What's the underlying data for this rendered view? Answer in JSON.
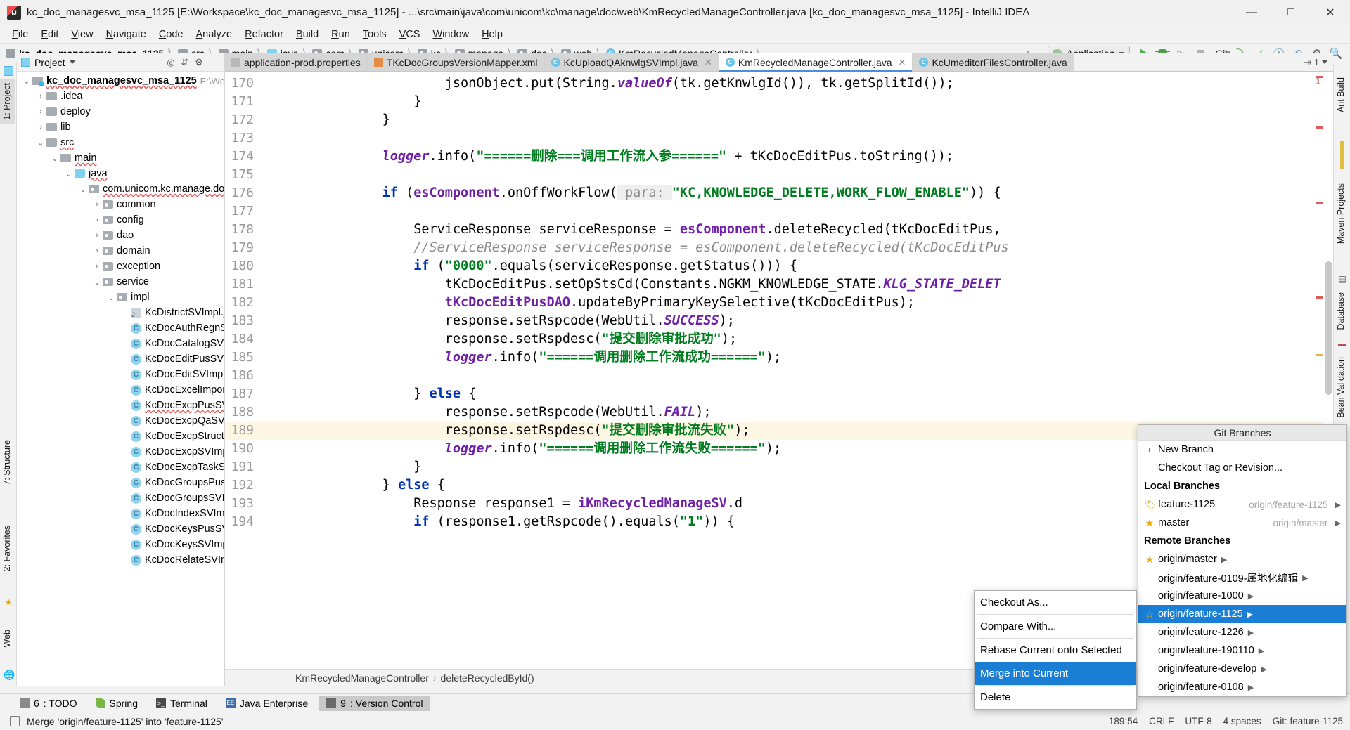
{
  "window": {
    "title": "kc_doc_managesvc_msa_1125 [E:\\Workspace\\kc_doc_managesvc_msa_1125] - ...\\src\\main\\java\\com\\unicom\\kc\\manage\\doc\\web\\KmRecycledManageController.java [kc_doc_managesvc_msa_1125] - IntelliJ IDEA",
    "minimize": "—",
    "maximize": "□",
    "close": "✕"
  },
  "menubar": [
    "File",
    "Edit",
    "View",
    "Navigate",
    "Code",
    "Analyze",
    "Refactor",
    "Build",
    "Run",
    "Tools",
    "VCS",
    "Window",
    "Help"
  ],
  "navbar": {
    "crumbs": [
      {
        "label": "kc_doc_managesvc_msa_1125",
        "icon": "module-folder-icon",
        "type": "mod"
      },
      {
        "label": "src",
        "icon": "folder-icon",
        "type": "plain"
      },
      {
        "label": "main",
        "icon": "folder-icon",
        "type": "plain"
      },
      {
        "label": "java",
        "icon": "source-folder-icon",
        "type": "blue"
      },
      {
        "label": "com",
        "icon": "package-icon",
        "type": "pkg"
      },
      {
        "label": "unicom",
        "icon": "package-icon",
        "type": "pkg"
      },
      {
        "label": "kc",
        "icon": "package-icon",
        "type": "pkg"
      },
      {
        "label": "manage",
        "icon": "package-icon",
        "type": "pkg"
      },
      {
        "label": "doc",
        "icon": "package-icon",
        "type": "pkg"
      },
      {
        "label": "web",
        "icon": "package-icon",
        "type": "pkg"
      },
      {
        "label": "KmRecycledManageController",
        "icon": "class-icon",
        "type": "cls"
      }
    ],
    "run_config": "Application",
    "git_label": "Git:"
  },
  "left_strip": [
    {
      "label": "1: Project",
      "active": true
    },
    {
      "label": "7: Structure",
      "active": false
    },
    {
      "label": "2: Favorites",
      "active": false
    },
    {
      "label": "Web",
      "active": false
    }
  ],
  "right_strip": [
    {
      "label": "Ant Build"
    },
    {
      "label": "Maven Projects"
    },
    {
      "label": "Database"
    },
    {
      "label": "Bean Validation"
    }
  ],
  "project_panel": {
    "header": "Project",
    "tree": [
      {
        "indent": 0,
        "twisty": "⌄",
        "icon": "module-folder-icon",
        "kind": "mod",
        "label": "kc_doc_managesvc_msa_1125",
        "bold": true,
        "wavy": true,
        "suffix": "E:\\Workspa"
      },
      {
        "indent": 1,
        "twisty": "›",
        "icon": "folder-icon",
        "kind": "plain",
        "label": ".idea"
      },
      {
        "indent": 1,
        "twisty": "›",
        "icon": "folder-icon",
        "kind": "plain",
        "label": "deploy"
      },
      {
        "indent": 1,
        "twisty": "›",
        "icon": "folder-icon",
        "kind": "plain",
        "label": "lib"
      },
      {
        "indent": 1,
        "twisty": "⌄",
        "icon": "folder-icon",
        "kind": "plain",
        "label": "src",
        "wavy": true
      },
      {
        "indent": 2,
        "twisty": "⌄",
        "icon": "folder-icon",
        "kind": "plain",
        "label": "main",
        "wavy": true
      },
      {
        "indent": 3,
        "twisty": "⌄",
        "icon": "source-folder-icon",
        "kind": "blue",
        "label": "java",
        "wavy": true
      },
      {
        "indent": 4,
        "twisty": "⌄",
        "icon": "package-icon",
        "kind": "pkg",
        "label": "com.unicom.kc.manage.doc",
        "wavy": true
      },
      {
        "indent": 5,
        "twisty": "›",
        "icon": "package-icon",
        "kind": "pkg",
        "label": "common"
      },
      {
        "indent": 5,
        "twisty": "›",
        "icon": "package-icon",
        "kind": "pkg",
        "label": "config"
      },
      {
        "indent": 5,
        "twisty": "›",
        "icon": "package-icon",
        "kind": "pkg",
        "label": "dao"
      },
      {
        "indent": 5,
        "twisty": "›",
        "icon": "package-icon",
        "kind": "pkg",
        "label": "domain"
      },
      {
        "indent": 5,
        "twisty": "›",
        "icon": "package-icon",
        "kind": "pkg",
        "label": "exception"
      },
      {
        "indent": 5,
        "twisty": "⌄",
        "icon": "package-icon",
        "kind": "pkg",
        "label": "service"
      },
      {
        "indent": 6,
        "twisty": "⌄",
        "icon": "package-icon",
        "kind": "pkg",
        "label": "impl"
      },
      {
        "indent": 7,
        "twisty": "",
        "icon": "java-file-icon",
        "kind": "java",
        "label": "KcDistrictSVImpl.jav"
      },
      {
        "indent": 7,
        "twisty": "",
        "icon": "class-icon",
        "kind": "cls",
        "label": "KcDocAuthRegnSVI"
      },
      {
        "indent": 7,
        "twisty": "",
        "icon": "class-icon",
        "kind": "cls",
        "label": "KcDocCatalogSVIm"
      },
      {
        "indent": 7,
        "twisty": "",
        "icon": "class-icon",
        "kind": "cls",
        "label": "KcDocEditPusSVImp"
      },
      {
        "indent": 7,
        "twisty": "",
        "icon": "class-icon",
        "kind": "cls",
        "label": "KcDocEditSVImpl"
      },
      {
        "indent": 7,
        "twisty": "",
        "icon": "class-icon",
        "kind": "cls",
        "label": "KcDocExcelImportS"
      },
      {
        "indent": 7,
        "twisty": "",
        "icon": "class-icon",
        "kind": "cls",
        "label": "KcDocExcpPusSVIm",
        "wavy": true
      },
      {
        "indent": 7,
        "twisty": "",
        "icon": "class-icon",
        "kind": "cls",
        "label": "KcDocExcpQaSVImp"
      },
      {
        "indent": 7,
        "twisty": "",
        "icon": "class-icon",
        "kind": "cls",
        "label": "KcDocExcpStructSV"
      },
      {
        "indent": 7,
        "twisty": "",
        "icon": "class-icon",
        "kind": "cls",
        "label": "KcDocExcpSVImpl"
      },
      {
        "indent": 7,
        "twisty": "",
        "icon": "class-icon",
        "kind": "cls",
        "label": "KcDocExcpTaskSVIm"
      },
      {
        "indent": 7,
        "twisty": "",
        "icon": "class-icon",
        "kind": "cls",
        "label": "KcDocGroupsPusSV"
      },
      {
        "indent": 7,
        "twisty": "",
        "icon": "class-icon",
        "kind": "cls",
        "label": "KcDocGroupsSVImp"
      },
      {
        "indent": 7,
        "twisty": "",
        "icon": "class-icon",
        "kind": "cls",
        "label": "KcDocIndexSVImpl"
      },
      {
        "indent": 7,
        "twisty": "",
        "icon": "class-icon",
        "kind": "cls",
        "label": "KcDocKeysPusSVIm"
      },
      {
        "indent": 7,
        "twisty": "",
        "icon": "class-icon",
        "kind": "cls",
        "label": "KcDocKeysSVImpl"
      },
      {
        "indent": 7,
        "twisty": "",
        "icon": "class-icon",
        "kind": "cls",
        "label": "KcDocRelateSVImpl"
      }
    ]
  },
  "editor": {
    "tabs": [
      {
        "label": "application-prod.properties",
        "icon": "properties-file-icon",
        "kind": "prop",
        "active": false,
        "closable": false
      },
      {
        "label": "TKcDocGroupsVersionMapper.xml",
        "icon": "xml-file-icon",
        "kind": "xml",
        "active": false,
        "closable": false
      },
      {
        "label": "KcUploadQAknwlgSVImpl.java",
        "icon": "class-icon",
        "kind": "cls",
        "active": false,
        "closable": true
      },
      {
        "label": "KmRecycledManageController.java",
        "icon": "class-icon",
        "kind": "cls",
        "active": true,
        "closable": true
      },
      {
        "label": "KcUmeditorFilesController.java",
        "icon": "class-icon",
        "kind": "cls",
        "active": false,
        "closable": false
      }
    ],
    "tabs_overflow": "⇥ 1",
    "first_line": 170,
    "highlighted_line": 189,
    "lines": [
      {
        "n": 170,
        "html": "                    <span class=\"plain\">jsonObject.put(String.</span><span class=\"st\">valueOf</span><span class=\"plain\">(tk.getKnwlgId()), tk.getSplitId());</span>"
      },
      {
        "n": 171,
        "html": "                <span class=\"plain\">}</span>"
      },
      {
        "n": 172,
        "html": "            <span class=\"plain\">}</span>"
      },
      {
        "n": 173,
        "html": ""
      },
      {
        "n": 174,
        "html": "            <span class=\"st\">logger</span><span class=\"plain\">.info(</span><span class=\"str\">\"======删除===调用工作流入参======\"</span><span class=\"plain\"> + tKcDocEditPus.toString());</span>"
      },
      {
        "n": 175,
        "html": ""
      },
      {
        "n": 176,
        "html": "            <span class=\"kw\">if</span><span class=\"plain\"> (</span><span class=\"fld\">esComponent</span><span class=\"plain\">.onOffWorkFlow(</span><span class=\"hint\"> para: </span><span class=\"str\">\"KC,KNOWLEDGE_DELETE,WORK_FLOW_ENABLE\"</span><span class=\"plain\">)) {</span>"
      },
      {
        "n": 177,
        "html": ""
      },
      {
        "n": 178,
        "html": "                <span class=\"plain\">ServiceResponse serviceResponse = </span><span class=\"fld\">esComponent</span><span class=\"plain\">.deleteRecycled(tKcDocEditPus,</span>"
      },
      {
        "n": 179,
        "html": "                <span class=\"cmt\">//ServiceResponse serviceResponse = esComponent.deleteRecycled(tKcDocEditPus</span>"
      },
      {
        "n": 180,
        "html": "                <span class=\"kw\">if</span><span class=\"plain\"> (</span><span class=\"str\">\"0000\"</span><span class=\"plain\">.equals(serviceResponse.getStatus())) {</span>"
      },
      {
        "n": 181,
        "html": "                    <span class=\"plain\">tKcDocEditPus.setOpStsCd(Constants.NGKM_KNOWLEDGE_STATE.</span><span class=\"st\">KLG_STATE_DELET</span>"
      },
      {
        "n": 182,
        "html": "                    <span class=\"fld\">tKcDocEditPusDAO</span><span class=\"plain\">.updateByPrimaryKeySelective(tKcDocEditPus);</span>"
      },
      {
        "n": 183,
        "html": "                    <span class=\"plain\">response.setRspcode(WebUtil.</span><span class=\"st\">SUCCESS</span><span class=\"plain\">);</span>"
      },
      {
        "n": 184,
        "html": "                    <span class=\"plain\">response.setRspdesc(</span><span class=\"str\">\"提交删除审批成功\"</span><span class=\"plain\">);</span>"
      },
      {
        "n": 185,
        "html": "                    <span class=\"st\">logger</span><span class=\"plain\">.info(</span><span class=\"str\">\"======调用删除工作流成功======\"</span><span class=\"plain\">);</span>"
      },
      {
        "n": 186,
        "html": ""
      },
      {
        "n": 187,
        "html": "                <span class=\"plain\">} </span><span class=\"kw\">else</span><span class=\"plain\"> {</span>"
      },
      {
        "n": 188,
        "html": "                    <span class=\"plain\">response.setRspcode(WebUtil.</span><span class=\"st\">FAIL</span><span class=\"plain\">);</span>"
      },
      {
        "n": 189,
        "html": "                    <span class=\"plain\">response.setRspdesc(</span><span class=\"str\">\"提交删除审批流失败\"</span><span class=\"plain\">);</span>"
      },
      {
        "n": 190,
        "html": "                    <span class=\"st\">logger</span><span class=\"plain\">.info(</span><span class=\"str\">\"======调用删除工作流失败======\"</span><span class=\"plain\">);</span>"
      },
      {
        "n": 191,
        "html": "                <span class=\"plain\">}</span>"
      },
      {
        "n": 192,
        "html": "            <span class=\"plain\">} </span><span class=\"kw\">else</span><span class=\"plain\"> {</span>"
      },
      {
        "n": 193,
        "html": "                <span class=\"plain\">Response response1 = </span><span class=\"fld\">iKmRecycledManageSV</span><span class=\"plain\">.d</span>"
      },
      {
        "n": 194,
        "html": "                <span class=\"kw\">if</span><span class=\"plain\"> (response1.getRspcode().equals(</span><span class=\"str\">\"1\"</span><span class=\"plain\">)) {</span>"
      }
    ],
    "breadcrumb": [
      "KmRecycledManageController",
      "deleteRecycledById()"
    ]
  },
  "git_popup": {
    "title": "Git Branches",
    "actions": [
      {
        "label": "New Branch",
        "icon": "plus-icon"
      },
      {
        "label": "Checkout Tag or Revision...",
        "icon": ""
      }
    ],
    "local_header": "Local Branches",
    "local": [
      {
        "label": "feature-1125",
        "icon": "tag-icon",
        "track": "origin/feature-1125"
      },
      {
        "label": "master",
        "icon": "star-icon",
        "track": "origin/master"
      }
    ],
    "remote_header": "Remote Branches",
    "remote": [
      {
        "label": "origin/master",
        "icon": "star-icon",
        "selected": false
      },
      {
        "label": "origin/feature-0109-属地化编辑",
        "icon": "",
        "selected": false
      },
      {
        "label": "origin/feature-1000",
        "icon": "",
        "selected": false
      },
      {
        "label": "origin/feature-1125",
        "icon": "star-outline-icon",
        "selected": true
      },
      {
        "label": "origin/feature-1226",
        "icon": "",
        "selected": false
      },
      {
        "label": "origin/feature-190110",
        "icon": "",
        "selected": false
      },
      {
        "label": "origin/feature-develop",
        "icon": "",
        "selected": false
      },
      {
        "label": "origin/feature-0108",
        "icon": "",
        "selected": false
      }
    ]
  },
  "context_menu": [
    {
      "label": "Checkout As...",
      "selected": false,
      "sep_after": true
    },
    {
      "label": "Compare With...",
      "selected": false,
      "sep_after": true
    },
    {
      "label": "Rebase Current onto Selected",
      "selected": false,
      "sep_after": false
    },
    {
      "label": "Merge into Current",
      "selected": true,
      "sep_after": true
    },
    {
      "label": "Delete",
      "selected": false,
      "sep_after": false
    }
  ],
  "bottom_tabs": [
    {
      "num": "6",
      "label": ": TODO",
      "icon": "todo-icon",
      "kind": "todo",
      "active": false
    },
    {
      "num": "",
      "label": "Spring",
      "icon": "spring-icon",
      "kind": "spring",
      "active": false
    },
    {
      "num": "",
      "label": "Terminal",
      "icon": "terminal-icon",
      "kind": "term",
      "active": false
    },
    {
      "num": "",
      "label": "Java Enterprise",
      "icon": "java-enterprise-icon",
      "kind": "je",
      "active": false
    },
    {
      "num": "9",
      "label": ": Version Control",
      "icon": "version-control-icon",
      "kind": "vc",
      "active": true
    }
  ],
  "statusbar": {
    "message": "Merge 'origin/feature-1125' into 'feature-1125'",
    "position": "189:54",
    "line_sep": "CRLF",
    "encoding": "UTF-8",
    "indent": "4 spaces",
    "branch": "Git: feature-1125"
  },
  "colors": {
    "accent": "#1a7fd4",
    "keyword": "#0033b3",
    "string": "#007d1e",
    "field": "#6f1fa8",
    "comment": "#8c8c8c",
    "highlight_row": "#fdf6e3"
  }
}
